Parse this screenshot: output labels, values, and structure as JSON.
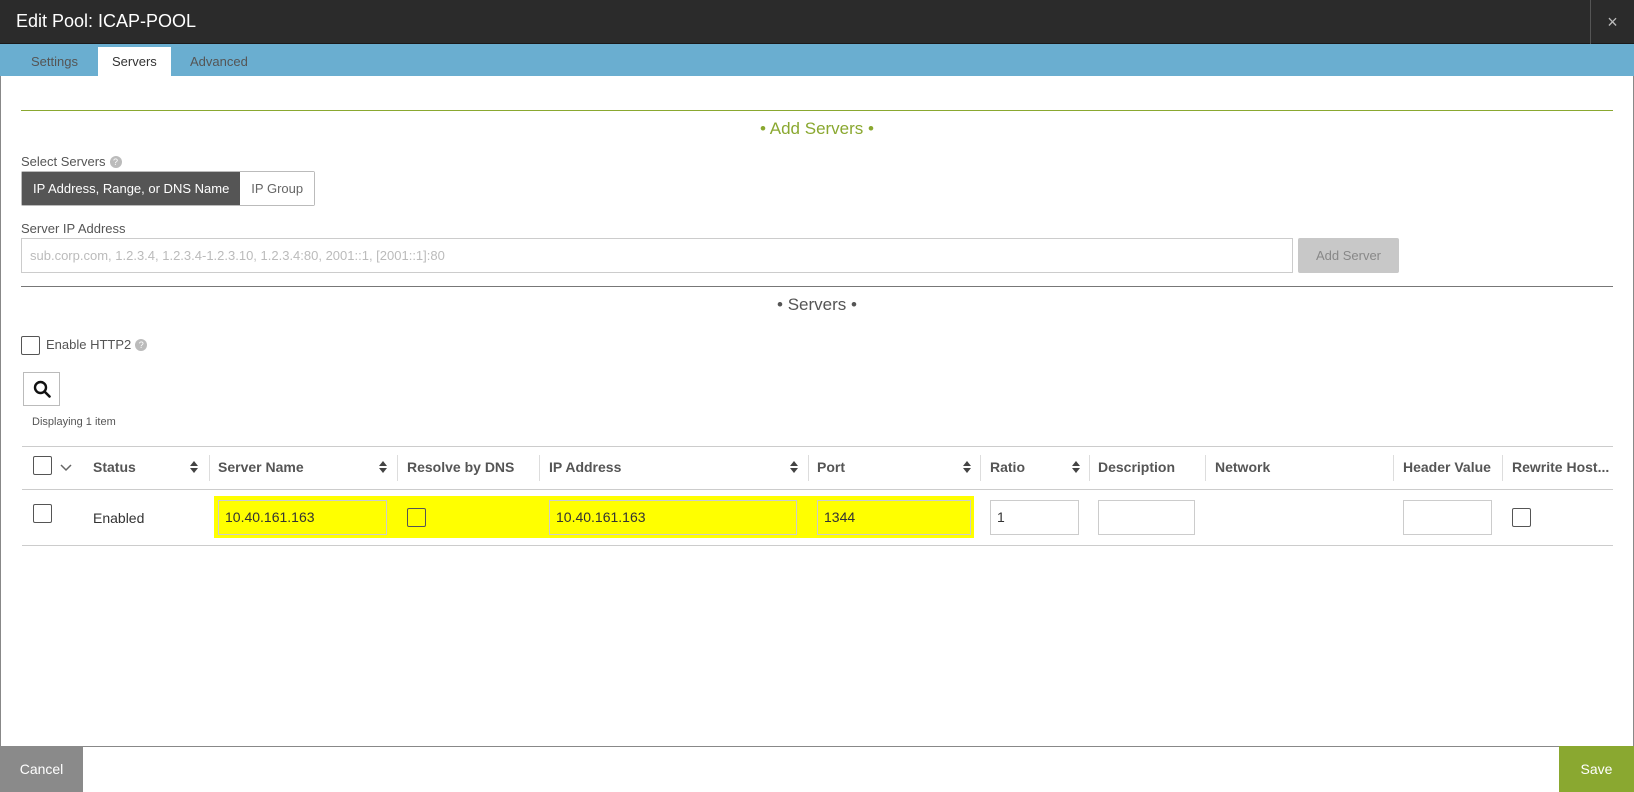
{
  "window": {
    "title": "Edit Pool: ICAP-POOL",
    "close_glyph": "×"
  },
  "tabs": [
    {
      "label": "Settings",
      "active": false
    },
    {
      "label": "Servers",
      "active": true
    },
    {
      "label": "Advanced",
      "active": false
    }
  ],
  "add_servers": {
    "heading": "• Add Servers •",
    "select_label": "Select Servers",
    "help_glyph": "?",
    "options": [
      "IP Address, Range, or DNS Name",
      "IP Group"
    ],
    "ip_label": "Server IP Address",
    "ip_placeholder": "sub.corp.com, 1.2.3.4, 1.2.3.4-1.2.3.10, 1.2.3.4:80, 2001::1, [2001::1]:80",
    "add_button": "Add Server"
  },
  "servers": {
    "heading": "• Servers •",
    "enable_http2_label": "Enable HTTP2",
    "displaying": "Displaying 1 item",
    "columns": [
      "Status",
      "Server Name",
      "Resolve by DNS",
      "IP Address",
      "Port",
      "Ratio",
      "Description",
      "Network",
      "Header Value",
      "Rewrite Host..."
    ],
    "rows": [
      {
        "status": "Enabled",
        "server_name": "10.40.161.163",
        "ip_address": "10.40.161.163",
        "port": "1344",
        "ratio": "1",
        "description": "",
        "header_value": ""
      }
    ]
  },
  "footer": {
    "cancel": "Cancel",
    "save": "Save"
  },
  "colors": {
    "accent_green": "#8aa830",
    "tab_bar": "#6aaed0",
    "title_bar": "#2b2b2b",
    "highlight": "#ffff00"
  }
}
